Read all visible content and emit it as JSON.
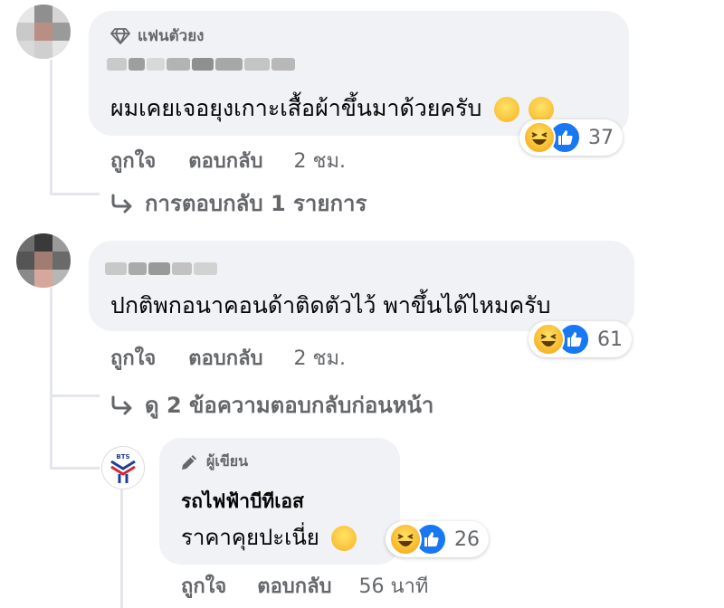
{
  "comments": [
    {
      "badge": "แฟนตัวยง",
      "text": "ผมเคยเจอยุงเกาะเสื้อผ้าขึ้นมาด้วยครับ",
      "inline_emojis": [
        "rolling-laughing-emoji",
        "grinning-sweat-emoji"
      ],
      "reactions": {
        "count": "37",
        "types": [
          "haha",
          "like"
        ]
      },
      "actions": {
        "like": "ถูกใจ",
        "reply": "ตอบกลับ",
        "time": "2 ชม."
      },
      "reply_link": "การตอบกลับ 1 รายการ"
    },
    {
      "text": "ปกติพกอนาคอนด้าติดตัวไว้ พาขึ้นได้ไหมครับ",
      "reactions": {
        "count": "61",
        "types": [
          "haha",
          "like"
        ]
      },
      "actions": {
        "like": "ถูกใจ",
        "reply": "ตอบกลับ",
        "time": "2 ชม."
      },
      "reply_link": "ดู 2 ข้อความตอบกลับก่อนหน้า"
    }
  ],
  "reply": {
    "badge": "ผู้เขียน",
    "author": "รถไฟฟ้าบีทีเอส",
    "text": "ราคาคุยปะเนี่ย",
    "inline_emojis": [
      "grinning-sweat-emoji"
    ],
    "reactions": {
      "count": "26",
      "types": [
        "haha",
        "like"
      ]
    },
    "actions": {
      "like": "ถูกใจ",
      "reply": "ตอบกลับ",
      "time": "56 นาที"
    },
    "avatar_logo_text": "BTS"
  },
  "colors": {
    "bubble": "#f0f2f5",
    "secondary_text": "#65676b",
    "like_blue": "#1877f2",
    "haha_yellow": "#f7b125",
    "thread_line": "#e4e6eb"
  }
}
